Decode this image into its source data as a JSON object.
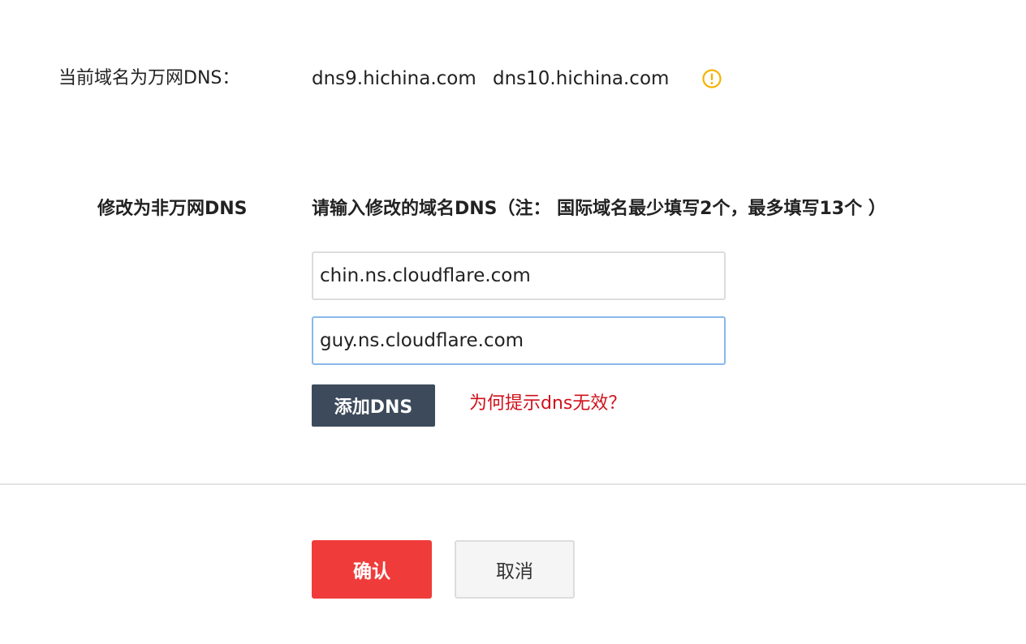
{
  "current": {
    "label": "当前域名为万网DNS：",
    "dns_servers": [
      "dns9.hichina.com",
      "dns10.hichina.com"
    ],
    "warning_icon": "exclamation-circle-icon",
    "warning_color": "#f5b301"
  },
  "modify": {
    "label": "修改为非万网DNS",
    "hint": "请输入修改的域名DNS（注： 国际域名最少填写2个，最多填写13个 ）",
    "inputs": [
      {
        "value": "chin.ns.cloudflare.com"
      },
      {
        "value": "guy.ns.cloudflare.com"
      }
    ],
    "add_button_label": "添加DNS",
    "help_link": "为何提示dns无效？"
  },
  "actions": {
    "confirm_label": "确认",
    "cancel_label": "取消"
  },
  "colors": {
    "confirm": "#ef3c3a",
    "add_button": "#3c4a5b",
    "link": "#d0111b",
    "input_focus": "#8ab8ea"
  }
}
